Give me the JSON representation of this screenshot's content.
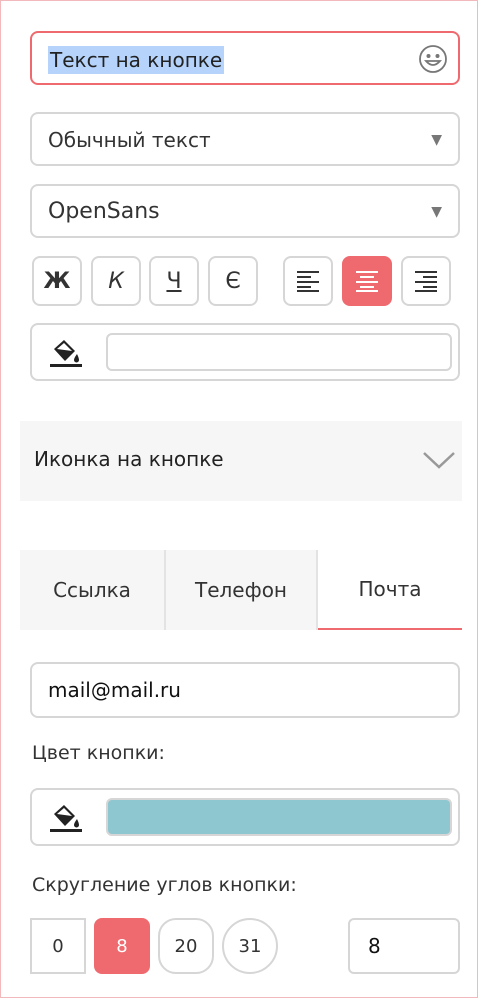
{
  "button_text_field": {
    "value": "Текст на кнопке",
    "icon": "smiley-icon"
  },
  "text_style_select": {
    "value": "Обычный текст"
  },
  "font_select": {
    "value": "OpenSans"
  },
  "format_buttons": {
    "bold": "Ж",
    "italic": "К",
    "underline": "Ч",
    "strike": "Є"
  },
  "align_buttons": {
    "active": "center"
  },
  "text_color": {
    "value": ""
  },
  "icon_section": {
    "label": "Иконка на кнопке"
  },
  "tabs": [
    {
      "label": "Ссылка",
      "active": false
    },
    {
      "label": "Телефон",
      "active": false
    },
    {
      "label": "Почта",
      "active": true
    }
  ],
  "email_field": {
    "value": "mail@mail.ru"
  },
  "button_color": {
    "label": "Цвет кнопки:",
    "value": "#8fc7d1"
  },
  "corner_radius": {
    "label": "Скругление углов кнопки:",
    "presets": [
      "0",
      "8",
      "20",
      "31"
    ],
    "selected": "8",
    "value": "8"
  },
  "colors": {
    "accent": "#ef6a6f",
    "border": "#d6d6d6",
    "panel": "#f6f6f6"
  }
}
